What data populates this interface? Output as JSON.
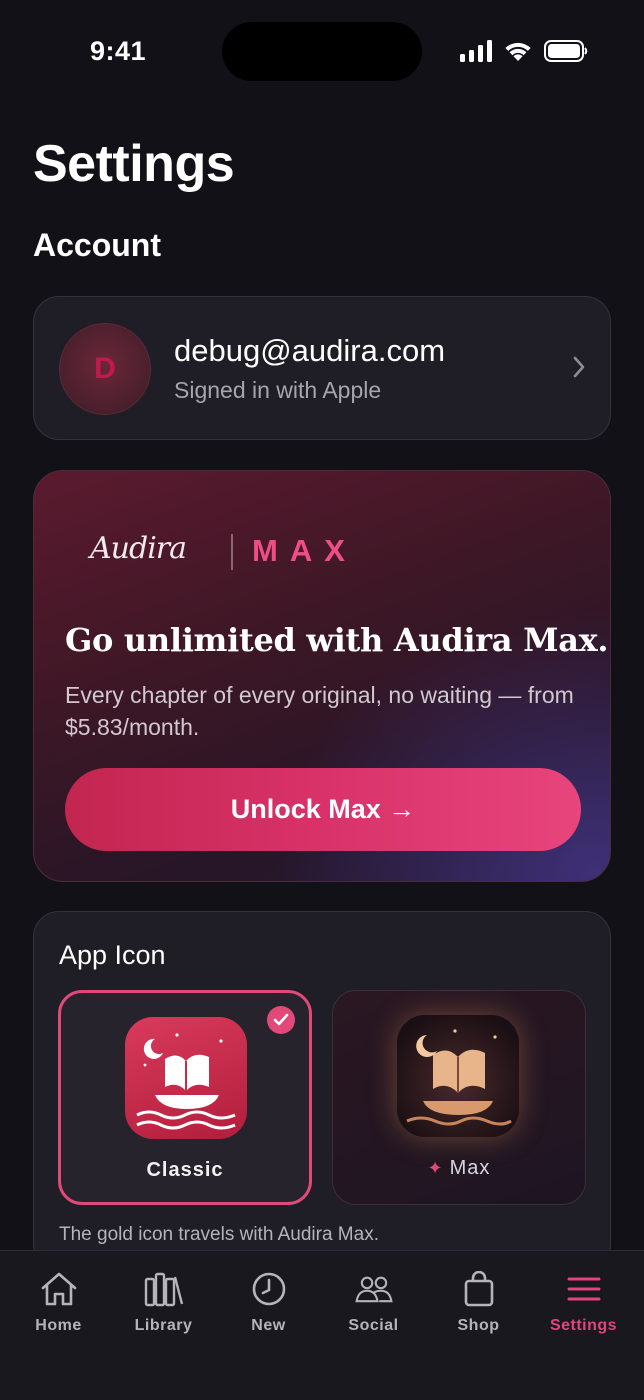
{
  "status_bar": {
    "time": "9:41"
  },
  "page": {
    "title": "Settings",
    "section": "Account"
  },
  "account": {
    "avatar_initial": "D",
    "email": "debug@audira.com",
    "subtitle": "Signed in with Apple"
  },
  "promo": {
    "brand_logo": "Audira",
    "brand_tier": "MAX",
    "headline": "Go unlimited with Audira Max.",
    "body": "Every chapter of every original, no waiting — from $5.83/month.",
    "button_label": "Unlock Max →"
  },
  "app_icon": {
    "title": "App Icon",
    "options": [
      {
        "label": "Classic",
        "selected": true
      },
      {
        "label": "Max",
        "selected": false
      }
    ],
    "note": "The gold icon travels with Audira Max."
  },
  "tab_bar": {
    "tabs": [
      {
        "label": "Home",
        "icon": "home-icon"
      },
      {
        "label": "Library",
        "icon": "library-icon"
      },
      {
        "label": "New",
        "icon": "clock-icon"
      },
      {
        "label": "Social",
        "icon": "people-icon"
      },
      {
        "label": "Shop",
        "icon": "bag-icon"
      },
      {
        "label": "Settings",
        "icon": "menu-icon",
        "active": true
      }
    ]
  },
  "colors": {
    "accent": "#E14978",
    "background": "#121118",
    "card": "#1F1E26"
  }
}
